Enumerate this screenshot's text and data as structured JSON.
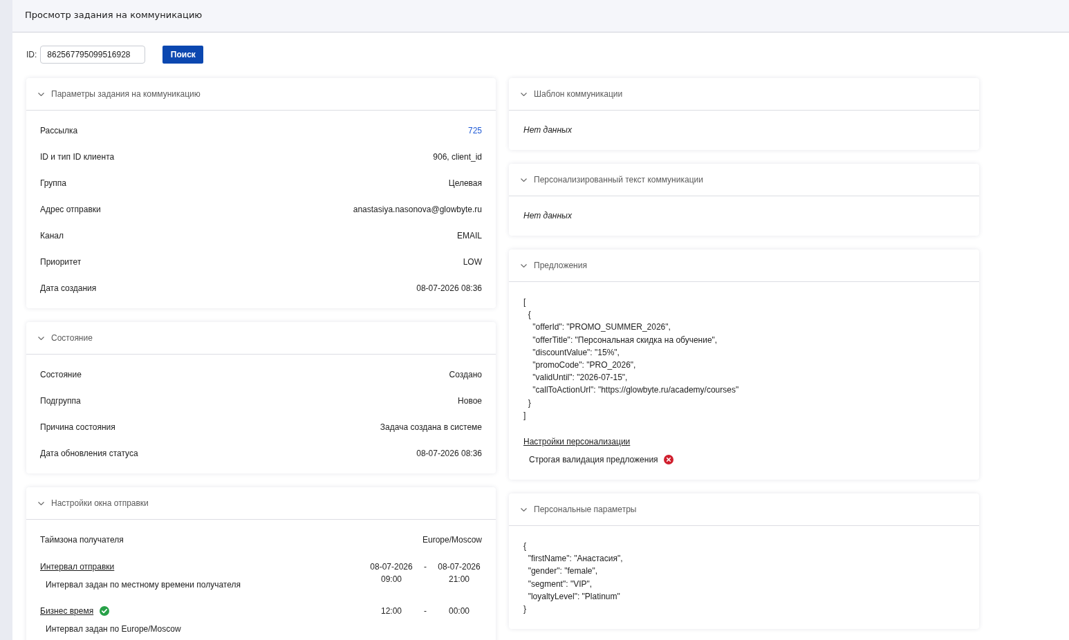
{
  "header": {
    "title": "Просмотр задания на коммуникацию"
  },
  "search": {
    "label": "ID:",
    "value": "862567795099516928",
    "button": "Поиск"
  },
  "columns": [
    {
      "panels": [
        {
          "kind": "fields",
          "title": "Параметры задания на коммуникацию",
          "expanded": true,
          "rows": [
            {
              "kind": "link",
              "label": "Рассылка",
              "value": "725"
            },
            {
              "kind": "text",
              "label": "ID и тип ID клиента",
              "value": "906, client_id"
            },
            {
              "kind": "text",
              "label": "Группа",
              "value": "Целевая"
            },
            {
              "kind": "text",
              "label": "Адрес отправки",
              "value": "anastasiya.nasonova@glowbyte.ru"
            },
            {
              "kind": "text",
              "label": "Канал",
              "value": "EMAIL"
            },
            {
              "kind": "text",
              "label": "Приоритет",
              "value": "LOW"
            },
            {
              "kind": "text",
              "label": "Дата создания",
              "value": "08-07-2026 08:36"
            }
          ]
        },
        {
          "kind": "fields",
          "title": "Состояние",
          "expanded": true,
          "rows": [
            {
              "kind": "text",
              "label": "Состояние",
              "value": "Создано"
            },
            {
              "kind": "text",
              "label": "Подгруппа",
              "value": "Новое"
            },
            {
              "kind": "text",
              "label": "Причина состояния",
              "value": "Задача создана в системе"
            },
            {
              "kind": "text",
              "label": "Дата обновления статуса",
              "value": "08-07-2026 08:36"
            }
          ]
        },
        {
          "kind": "fields",
          "title": "Настройки окна отправки",
          "expanded": true,
          "rows": [
            {
              "kind": "text",
              "label": "Таймзона получателя",
              "value": "Europe/Moscow"
            },
            {
              "kind": "interval",
              "label": "Интервал отправки",
              "note": "Интервал задан по местному времени получателя",
              "from": "08-07-2026 09:00",
              "separator": "-",
              "to": "08-07-2026 21:00"
            },
            {
              "kind": "interval",
              "label": "Бизнес время",
              "enabled": true,
              "note": "Интервал задан по Europe/Moscow",
              "from": "12:00",
              "separator": "-",
              "to": "00:00"
            }
          ]
        }
      ]
    },
    {
      "panels": [
        {
          "kind": "empty",
          "title": "Шаблон коммуникации",
          "expanded": true,
          "text": "Нет данных"
        },
        {
          "kind": "empty",
          "title": "Персонализированный текст коммуникации",
          "expanded": true,
          "text": "Нет данных"
        },
        {
          "kind": "code",
          "title": "Предложения",
          "expanded": true,
          "code": "[\n  {\n    \"offerId\": \"PROMO_SUMMER_2026\",\n    \"offerTitle\": \"Персональная скидка на обучение\",\n    \"discountValue\": \"15%\",\n    \"promoCode\": \"PRO_2026\",\n    \"validUntil\": \"2026-07-15\",\n    \"callToActionUrl\": \"https://glowbyte.ru/academy/courses\"\n  }\n]",
          "settings": {
            "title": "Настройки персонализации",
            "items": [
              {
                "label": "Строгая валидация предложения",
                "enabled": false
              }
            ]
          }
        },
        {
          "kind": "code",
          "title": "Персональные параметры",
          "expanded": true,
          "code": "{\n  \"firstName\": \"Анастасия\",\n  \"gender\": \"female\",\n  \"segment\": \"VIP\",\n  \"loyaltyLevel\": \"Platinum\"\n}"
        }
      ]
    }
  ]
}
